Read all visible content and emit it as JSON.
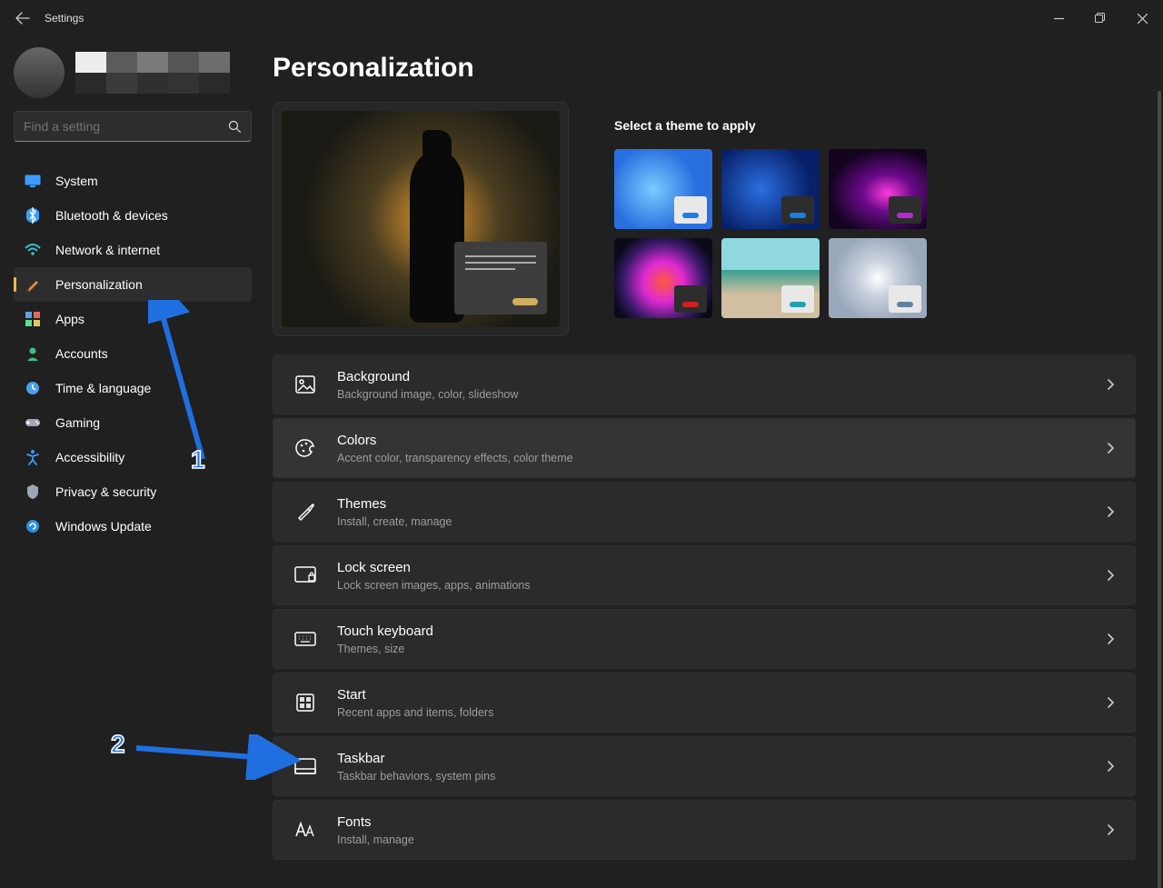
{
  "window": {
    "app_title": "Settings"
  },
  "search": {
    "placeholder": "Find a setting"
  },
  "sidebar": {
    "items": [
      {
        "icon": "system-icon",
        "label": "System",
        "color": "#3a9dff"
      },
      {
        "icon": "bluetooth-icon",
        "label": "Bluetooth & devices",
        "color": "#3a9dff"
      },
      {
        "icon": "wifi-icon",
        "label": "Network & internet",
        "color": "#37c1d0"
      },
      {
        "icon": "personalization-icon",
        "label": "Personalization",
        "color": "#e8883a"
      },
      {
        "icon": "apps-icon",
        "label": "Apps",
        "color": "#7aa0d4"
      },
      {
        "icon": "accounts-icon",
        "label": "Accounts",
        "color": "#3fbf7f"
      },
      {
        "icon": "time-icon",
        "label": "Time & language",
        "color": "#4aa0e8"
      },
      {
        "icon": "gaming-icon",
        "label": "Gaming",
        "color": "#9ea6b4"
      },
      {
        "icon": "accessibility-icon",
        "label": "Accessibility",
        "color": "#3a9dff"
      },
      {
        "icon": "privacy-icon",
        "label": "Privacy & security",
        "color": "#9ea6b4"
      },
      {
        "icon": "update-icon",
        "label": "Windows Update",
        "color": "#2d8fe0"
      }
    ],
    "active_index": 3
  },
  "page": {
    "title": "Personalization",
    "themes_header": "Select a theme to apply",
    "themes": [
      {
        "bg": "radial-gradient(circle at 40% 50%, #7acbff 0%, #2a6fe0 60%)",
        "chip_bg": "#e8e8e8",
        "bar": "#1a7fe0"
      },
      {
        "bg": "radial-gradient(circle at 40% 50%, #2a6fe0 0%, #08206a 70%)",
        "chip_bg": "#2d2d2d",
        "bar": "#1a7fe0"
      },
      {
        "bg": "radial-gradient(ellipse at 60% 55%, #ff3adf 0%, #6a0a8a 30%, #140420 70%)",
        "chip_bg": "#2d2d2d",
        "bar": "#b52ad4"
      },
      {
        "bg": "radial-gradient(circle at 50% 55%, #ff5a3a 0%, #e02ad4 30%, #3a1a6a 60%, #0a0a1a 80%)",
        "chip_bg": "#2d2d2d",
        "bar": "#d02020"
      },
      {
        "bg": "linear-gradient(#8fd8e0 40%, #3aa090 40%, #d0bfa0 70%)",
        "chip_bg": "#e8e8e8",
        "bar": "#20a0b0"
      },
      {
        "bg": "radial-gradient(circle at 50% 50%, #ffffff 0%, #c8d0dc 30%, #9aa8bc 70%)",
        "chip_bg": "#e8e8e8",
        "bar": "#6080a0"
      }
    ],
    "cards": [
      {
        "icon": "image-icon",
        "title": "Background",
        "sub": "Background image, color, slideshow"
      },
      {
        "icon": "palette-icon",
        "title": "Colors",
        "sub": "Accent color, transparency effects, color theme"
      },
      {
        "icon": "brush-icon",
        "title": "Themes",
        "sub": "Install, create, manage"
      },
      {
        "icon": "lock-screen-icon",
        "title": "Lock screen",
        "sub": "Lock screen images, apps, animations"
      },
      {
        "icon": "keyboard-icon",
        "title": "Touch keyboard",
        "sub": "Themes, size"
      },
      {
        "icon": "start-icon",
        "title": "Start",
        "sub": "Recent apps and items, folders"
      },
      {
        "icon": "taskbar-icon",
        "title": "Taskbar",
        "sub": "Taskbar behaviors, system pins"
      },
      {
        "icon": "fonts-icon",
        "title": "Fonts",
        "sub": "Install, manage"
      }
    ],
    "hover_index": 1
  },
  "annotations": {
    "one": "1",
    "two": "2"
  }
}
